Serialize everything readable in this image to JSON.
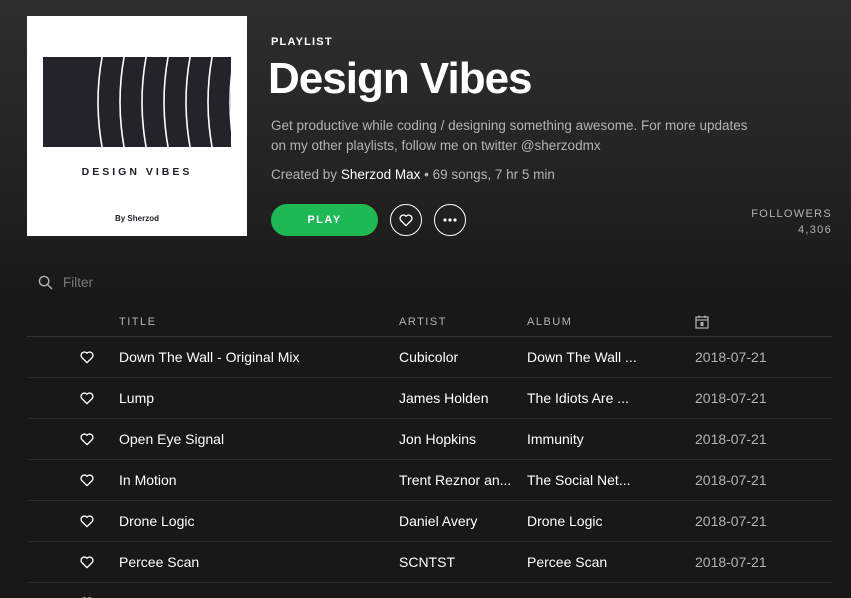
{
  "cover": {
    "title": "DESIGN VIBES",
    "by": "By Sherzod"
  },
  "playlist": {
    "kind": "PLAYLIST",
    "title": "Design Vibes",
    "description": "Get productive while coding / designing something awesome. For more updates on my other playlists, follow me on twitter @sherzodmx",
    "created_by_label": "Created by",
    "owner": "Sherzod Max",
    "stats": " • 69 songs, 7 hr 5 min"
  },
  "actions": {
    "play_label": "PLAY",
    "heart_icon": "heart-outline-icon",
    "more_icon": "more-horizontal-icon"
  },
  "followers": {
    "label": "FOLLOWERS",
    "count": "4,306"
  },
  "filter": {
    "placeholder": "Filter"
  },
  "columns": {
    "title": "TITLE",
    "artist": "ARTIST",
    "album": "ALBUM",
    "date_icon": "calendar-icon"
  },
  "colors": {
    "accent": "#1db954",
    "background": "#181818",
    "muted_text": "#b3b3b3"
  },
  "tracks": [
    {
      "title": "Down The Wall - Original Mix",
      "artist": "Cubicolor",
      "album": "Down The Wall ...",
      "date": "2018-07-21"
    },
    {
      "title": "Lump",
      "artist": "James Holden",
      "album": "The Idiots Are ...",
      "date": "2018-07-21"
    },
    {
      "title": "Open Eye Signal",
      "artist": "Jon Hopkins",
      "album": "Immunity",
      "date": "2018-07-21"
    },
    {
      "title": "In Motion",
      "artist": "Trent Reznor an...",
      "album": "The Social Net...",
      "date": "2018-07-21"
    },
    {
      "title": "Drone Logic",
      "artist": "Daniel Avery",
      "album": "Drone Logic",
      "date": "2018-07-21"
    },
    {
      "title": "Percee Scan",
      "artist": "SCNTST",
      "album": "Percee Scan",
      "date": "2018-07-21"
    },
    {
      "title": "",
      "artist": "",
      "album": "",
      "date": ""
    }
  ]
}
